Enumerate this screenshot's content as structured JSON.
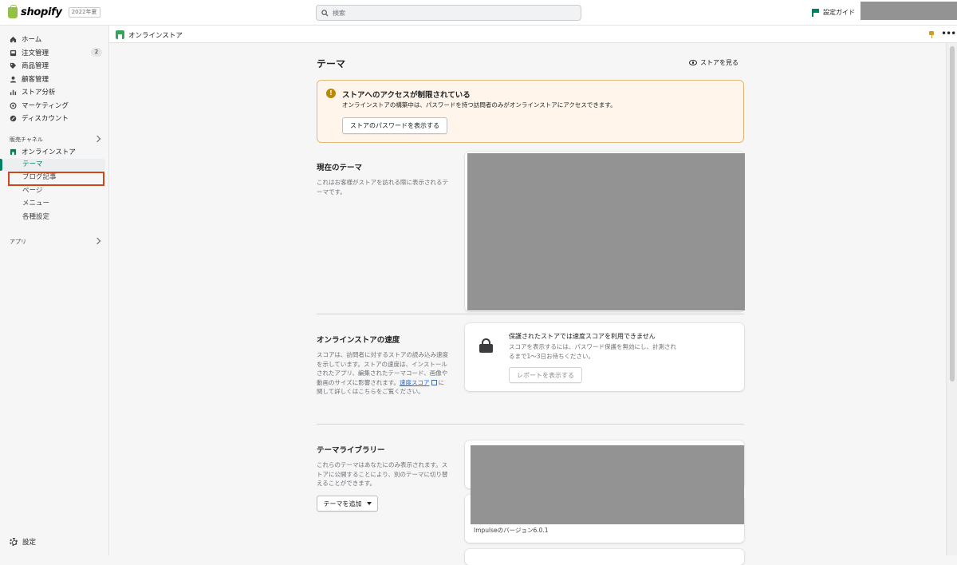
{
  "topbar": {
    "logo": "shopify",
    "edition": "2022年夏",
    "search_placeholder": "検索",
    "setup_guide": "設定ガイド"
  },
  "sidebar": {
    "items": [
      {
        "label": "ホーム",
        "icon": "home-icon"
      },
      {
        "label": "注文管理",
        "icon": "inbox-icon",
        "badge": "2"
      },
      {
        "label": "商品管理",
        "icon": "tag-icon"
      },
      {
        "label": "顧客管理",
        "icon": "person-icon"
      },
      {
        "label": "ストア分析",
        "icon": "bar-chart-icon"
      },
      {
        "label": "マーケティング",
        "icon": "target-icon"
      },
      {
        "label": "ディスカウント",
        "icon": "discount-icon"
      }
    ],
    "sales_channels_label": "販売チャネル",
    "online_store_label": "オンラインストア",
    "sub_items": [
      "テーマ",
      "ブログ記事",
      "ページ",
      "メニュー",
      "各種設定"
    ],
    "apps_label": "アプリ",
    "settings_label": "設定"
  },
  "subheader": {
    "title": "オンラインストア"
  },
  "main": {
    "title": "テーマ",
    "view_store": "ストアを見る",
    "banner": {
      "title": "ストアへのアクセスが制限されている",
      "text": "オンラインストアの構築中は、パスワードを持つ訪問者のみがオンラインストアにアクセスできます。",
      "button": "ストアのパスワードを表示する"
    },
    "current_theme": {
      "title": "現在のテーマ",
      "desc": "これはお客様がストアを訪れる際に表示されるテーマです。"
    },
    "speed": {
      "title": "オンラインストアの速度",
      "desc_1": "スコアは、訪問者に対するストアの読み込み速度を示しています。ストアの速度は、インストールされたアプリ、編集されたテーマコード、画像や動画のサイズに影響されます。",
      "link": "速度スコア",
      "desc_2": "に関して詳しくはこちらをご覧ください。",
      "card_title": "保護されたストアでは速度スコアを利用できません",
      "card_text": "スコアを表示するには、パスワード保護を無効にし、計測されるまで1〜3日お待ちください。",
      "card_button": "レポートを表示する"
    },
    "library": {
      "title": "テーマライブラリー",
      "desc": "これらのテーマはあなたにのみ表示されます。ストアに公開することにより、別のテーマに切り替えることができます。",
      "add_button": "テーマを追加",
      "version": "Impulseのバージョン6.0.1"
    }
  }
}
